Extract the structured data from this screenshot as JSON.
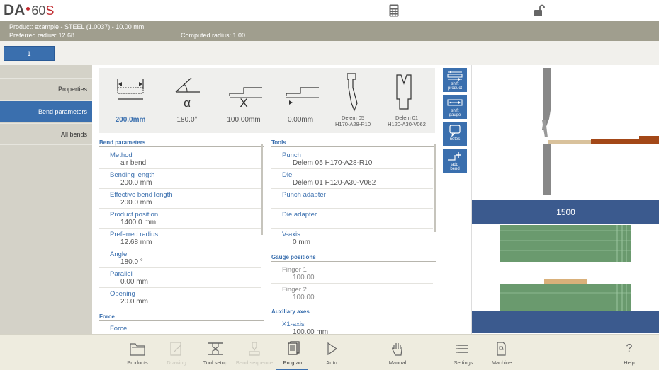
{
  "logo": {
    "brand": "DA",
    "model": "60",
    "model_suffix": "S"
  },
  "info": {
    "product": "Product: example - STEEL (1.0037) - 10.00 mm",
    "preferred_radius": "Preferred radius: 12.68",
    "computed_radius": "Computed radius: 1.00"
  },
  "bend_tab": "1",
  "nav": {
    "items": [
      "Properties",
      "Bend parameters",
      "All bends"
    ],
    "active": "Bend parameters"
  },
  "summary": {
    "length": "200.0mm",
    "angle_symbol": "α",
    "angle": "180.0°",
    "x_symbol": "X",
    "x": "100.00mm",
    "r": "0.00mm",
    "punch": "Delem 05\nH170-A28-R10",
    "punch_l1": "Delem 05",
    "punch_l2": "H170-A28-R10",
    "die_l1": "Delem 01",
    "die_l2": "H120-A30-V062"
  },
  "side_buttons": [
    {
      "l1": "shift",
      "l2": "product"
    },
    {
      "l1": "shift",
      "l2": "gauge"
    },
    {
      "l1": "notes",
      "l2": ""
    },
    {
      "l1": "add",
      "l2": "bend"
    }
  ],
  "bend_params": {
    "header": "Bend parameters",
    "rows": [
      {
        "label": "Method",
        "value": "air bend"
      },
      {
        "label": "Bending length",
        "value": "200.0 mm"
      },
      {
        "label": "Effective bend length",
        "value": "200.0 mm"
      },
      {
        "label": "Product position",
        "value": "1400.0 mm"
      },
      {
        "label": "Preferred radius",
        "value": "12.68 mm"
      },
      {
        "label": "Angle",
        "value": "180.0 °"
      },
      {
        "label": "Parallel",
        "value": "0.00 mm"
      },
      {
        "label": "Opening",
        "value": "20.0 mm"
      }
    ],
    "force_header": "Force",
    "force_label": "Force"
  },
  "tools": {
    "header": "Tools",
    "rows": [
      {
        "label": "Punch",
        "value": "Delem 05 H170-A28-R10"
      },
      {
        "label": "Die",
        "value": "Delem 01 H120-A30-V062"
      },
      {
        "label": "Punch adapter",
        "value": ""
      },
      {
        "label": "Die adapter",
        "value": ""
      },
      {
        "label": "V-axis",
        "value": "0 mm"
      }
    ],
    "gauge_header": "Gauge positions",
    "gauge_rows": [
      {
        "label": "Finger 1",
        "value": "100.00"
      },
      {
        "label": "Finger 2",
        "value": "100.00"
      }
    ],
    "aux_header": "Auxiliary axes",
    "aux_rows": [
      {
        "label": "X1-axis",
        "value": "100.00 mm"
      }
    ]
  },
  "preview": {
    "length_label": "1500"
  },
  "bottom": {
    "items": [
      {
        "label": "Products",
        "icon": "folder-icon",
        "state": "normal"
      },
      {
        "label": "Drawing",
        "icon": "drawing-icon",
        "state": "disabled"
      },
      {
        "label": "Tool setup",
        "icon": "tool-setup-icon",
        "state": "normal"
      },
      {
        "label": "Bend sequence",
        "icon": "bend-sequence-icon",
        "state": "disabled"
      },
      {
        "label": "Program",
        "icon": "program-icon",
        "state": "active"
      },
      {
        "label": "Auto",
        "icon": "play-icon",
        "state": "normal"
      },
      {
        "label": "Manual",
        "icon": "hand-icon",
        "state": "normal"
      },
      {
        "label": "Settings",
        "icon": "list-icon",
        "state": "normal"
      },
      {
        "label": "Machine",
        "icon": "machine-icon",
        "state": "normal"
      },
      {
        "label": "Help",
        "icon": "help-icon",
        "state": "normal"
      }
    ]
  },
  "colors": {
    "accent": "#3a6fae",
    "info_bar": "#a09e8e",
    "band": "#3b5a8e",
    "die_green": "#6a9a6e"
  }
}
